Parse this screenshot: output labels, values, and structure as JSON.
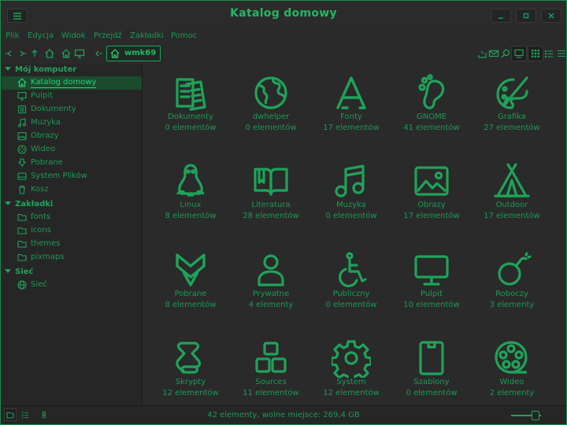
{
  "window": {
    "title": "Katalog domowy"
  },
  "menu": [
    "Plik",
    "Edycja",
    "Widok",
    "Przejdź",
    "Zakładki",
    "Pomoc"
  ],
  "location": {
    "path_label": "wmk69"
  },
  "sidebar": {
    "sections": [
      {
        "label": "Mój komputer",
        "items": [
          {
            "label": "Katalog domowy",
            "icon": "home-icon",
            "selected": true
          },
          {
            "label": "Pulpit",
            "icon": "monitor-icon"
          },
          {
            "label": "Dokumenty",
            "icon": "documents-icon"
          },
          {
            "label": "Muzyka",
            "icon": "music-icon"
          },
          {
            "label": "Obrazy",
            "icon": "picture-icon"
          },
          {
            "label": "Wideo",
            "icon": "film-icon"
          },
          {
            "label": "Pobrane",
            "icon": "download-icon"
          },
          {
            "label": "System Plików",
            "icon": "drive-icon"
          },
          {
            "label": "Kosz",
            "icon": "trash-icon"
          }
        ]
      },
      {
        "label": "Zakładki",
        "items": [
          {
            "label": "fonts",
            "icon": "folder-icon"
          },
          {
            "label": "icons",
            "icon": "folder-icon"
          },
          {
            "label": "themes",
            "icon": "folder-icon"
          },
          {
            "label": "pixmaps",
            "icon": "folder-icon"
          }
        ]
      },
      {
        "label": "Sieć",
        "items": [
          {
            "label": "Sieć",
            "icon": "network-icon"
          }
        ]
      }
    ]
  },
  "files": [
    {
      "name": "Dokumenty",
      "count": "0 elementów",
      "icon": "documents-icon"
    },
    {
      "name": "dwhelper",
      "count": "0 elementów",
      "icon": "globe-icon"
    },
    {
      "name": "Fonty",
      "count": "17 elementów",
      "icon": "font-icon"
    },
    {
      "name": "GNOME",
      "count": "41 elementów",
      "icon": "gnome-foot-icon"
    },
    {
      "name": "Grafika",
      "count": "27 elementów",
      "icon": "palette-icon"
    },
    {
      "name": "Linux",
      "count": "8 elementów",
      "icon": "tux-icon"
    },
    {
      "name": "Literatura",
      "count": "28 elementów",
      "icon": "book-icon"
    },
    {
      "name": "Muzyka",
      "count": "0 elementów",
      "icon": "music-icon"
    },
    {
      "name": "Obrazy",
      "count": "17 elementów",
      "icon": "picture-icon"
    },
    {
      "name": "Outdoor",
      "count": "17 elementów",
      "icon": "tent-icon"
    },
    {
      "name": "Pobrane",
      "count": "8 elementów",
      "icon": "download-icon"
    },
    {
      "name": "Prywatne",
      "count": "4 elementy",
      "icon": "person-icon"
    },
    {
      "name": "Publiczny",
      "count": "0 elementów",
      "icon": "accessibility-icon"
    },
    {
      "name": "Pulpit",
      "count": "10 elementów",
      "icon": "monitor-icon"
    },
    {
      "name": "Roboczy",
      "count": "3 elementy",
      "icon": "bomb-icon"
    },
    {
      "name": "Skrypty",
      "count": "12 elementów",
      "icon": "scroll-icon"
    },
    {
      "name": "Sources",
      "count": "11 elementów",
      "icon": "blocks-icon"
    },
    {
      "name": "System",
      "count": "12 elementów",
      "icon": "gear-icon"
    },
    {
      "name": "Szablony",
      "count": "0 elementów",
      "icon": "template-icon"
    },
    {
      "name": "Wideo",
      "count": "2 elementy",
      "icon": "film-reel-icon"
    }
  ],
  "status": {
    "text": "42 elementy, wolne miejsce: 269,4 GB"
  },
  "colors": {
    "accent": "#1fa35a",
    "accent_bright": "#2bd27a",
    "selection": "#1b4a2c",
    "background": "#2a2a2a"
  }
}
